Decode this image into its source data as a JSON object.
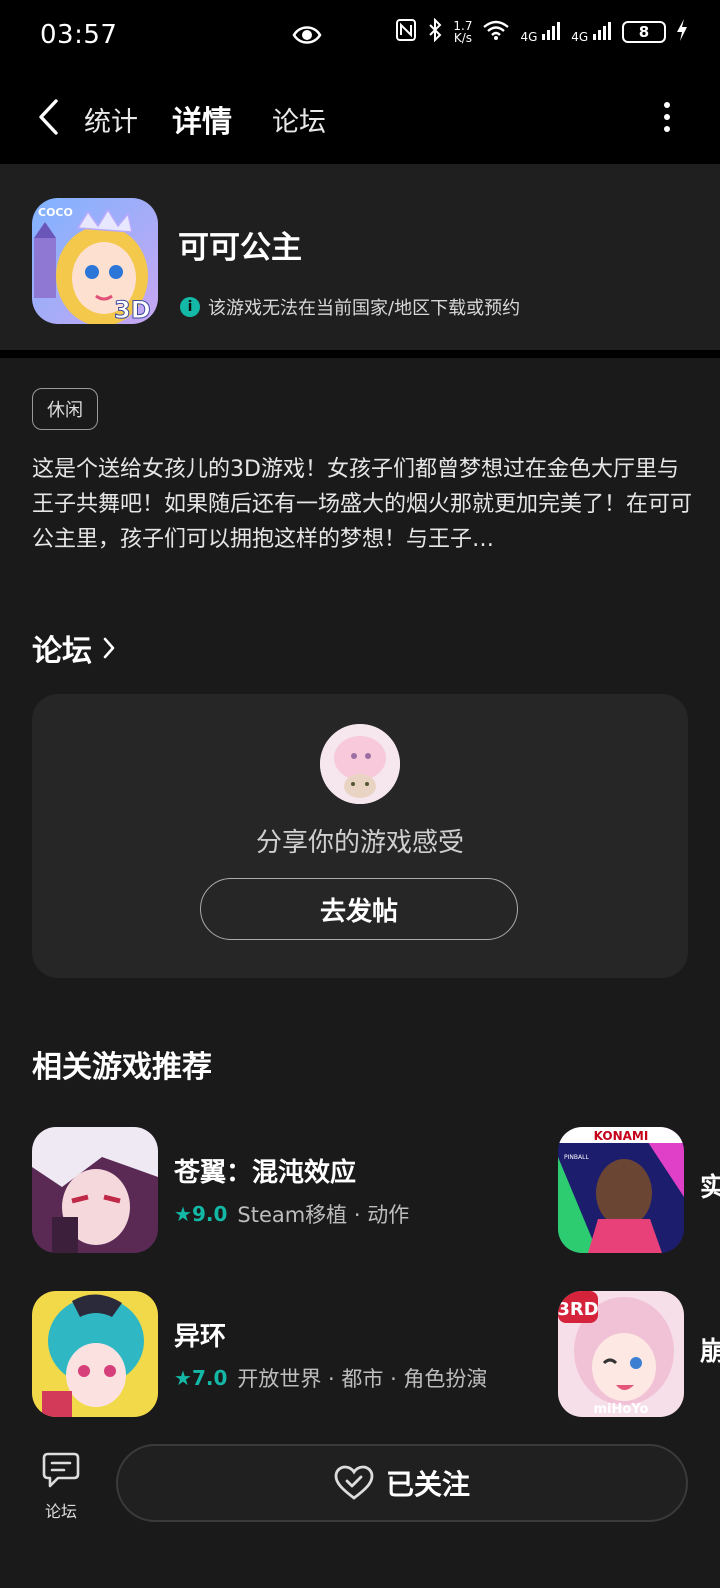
{
  "status_bar": {
    "time": "03:57",
    "net_speed_top": "1.7",
    "net_speed_bottom": "K/s",
    "sig1": "4G",
    "sig2": "4G",
    "battery": "8"
  },
  "nav": {
    "tabs": [
      "统计",
      "详情",
      "论坛"
    ],
    "active_tab": "详情"
  },
  "app": {
    "title": "可可公主",
    "notice": "该游戏无法在当前国家/地区下载或预约",
    "tag": "休闲",
    "description": "这是个送给女孩儿的3D游戏！女孩子们都曾梦想过在金色大厅里与王子共舞吧！如果随后还有一场盛大的烟火那就更加完美了！在可可公主里，孩子们可以拥抱这样的梦想！与王子…",
    "icon_labels": [
      "COCO",
      "3D"
    ]
  },
  "forum": {
    "heading": "论坛",
    "share_text": "分享你的游戏感受",
    "post_button": "去发帖"
  },
  "related": {
    "heading": "相关游戏推荐",
    "games": [
      {
        "name": "苍翼：混沌效应",
        "score": "9.0",
        "meta": "Steam移植 · 动作"
      },
      {
        "name": "异环",
        "score": "7.0",
        "meta": "开放世界 · 都市 · 角色扮演"
      },
      {
        "name": "实",
        "icon_label": "KONAMI",
        "icon_sublabel": "PINBALL"
      },
      {
        "name": "崩",
        "icon_label": "3RD",
        "icon_sublabel": "miHoYo"
      }
    ]
  },
  "bottom": {
    "forum_label": "论坛",
    "follow_label": "已关注"
  },
  "colors": {
    "accent": "#14b8a6",
    "background": "#1a1a1a",
    "card": "#262626"
  }
}
